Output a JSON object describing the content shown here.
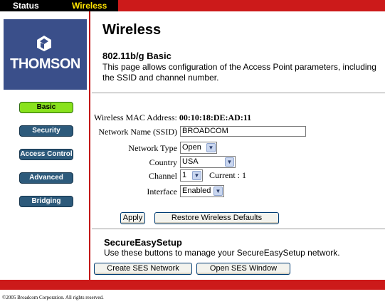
{
  "topbar": {
    "status_tab": "Status",
    "wireless_tab": "Wireless"
  },
  "brand": {
    "logo_text": "THOMSON",
    "colors": {
      "logo_bg": "#3a4f8a",
      "accent_red": "#cc1a1a",
      "nav_bg": "#2d5a7b",
      "nav_active": "#89e21d"
    }
  },
  "sidebar": {
    "items": [
      {
        "label": "Basic",
        "active": true
      },
      {
        "label": "Security",
        "active": false
      },
      {
        "label": "Access Control",
        "active": false
      },
      {
        "label": "Advanced",
        "active": false
      },
      {
        "label": "Bridging",
        "active": false
      }
    ]
  },
  "page": {
    "title": "Wireless",
    "subtitle": "802.11b/g Basic",
    "description": "This page allows configuration of the Access Point parameters, including the SSID and channel number."
  },
  "form": {
    "mac_label": "Wireless MAC Address:",
    "mac_value": "00:10:18:DE:AD:11",
    "ssid_label": "Network Name (SSID)",
    "ssid_value": "BROADCOM",
    "network_type_label": "Network Type",
    "network_type_value": "Open",
    "country_label": "Country",
    "country_value": "USA",
    "channel_label": "Channel",
    "channel_value": "1",
    "current_channel": "Current : 1",
    "interface_label": "Interface",
    "interface_value": "Enabled"
  },
  "actions": {
    "apply": "Apply",
    "restore": "Restore Wireless Defaults"
  },
  "ses": {
    "title": "SecureEasySetup",
    "description": "Use these buttons to manage your SecureEasySetup network.",
    "create_button": "Create SES Network",
    "open_button": "Open SES Window"
  },
  "footer": {
    "copyright": "©2005 Broadcom Corporation. All rights reserved."
  }
}
